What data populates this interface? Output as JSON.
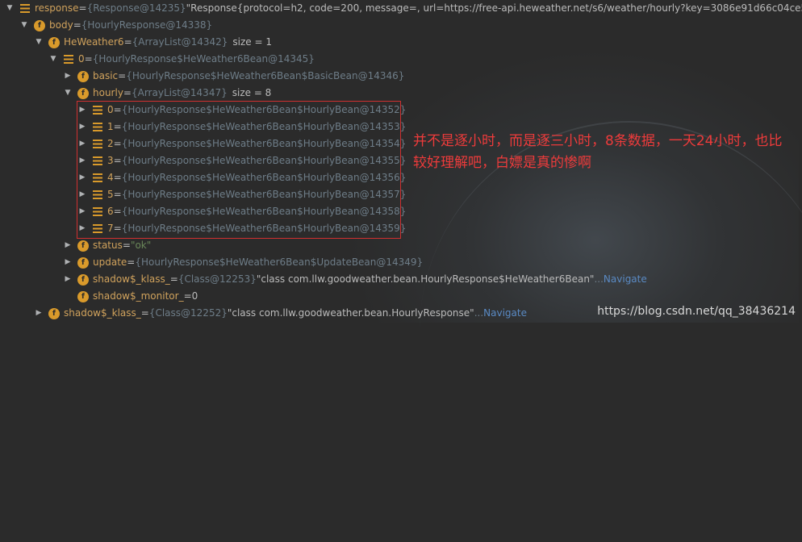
{
  "rows": [
    {
      "name": "response",
      "eq": " = ",
      "type": "{Response@14235}",
      "value": " \"Response{protocol=h2, code=200, message=, url=https://free-api.heweather.net/s6/weather/hourly?key=3086e91d66c04ce58...",
      "tail": " Vi"
    },
    {
      "name": "body",
      "eq": " = ",
      "type": "{HourlyResponse@14338}"
    },
    {
      "name": "HeWeather6",
      "eq": " = ",
      "type": "{ArrayList@14342}",
      "size": "size = 1"
    },
    {
      "name": "0",
      "eq": " = ",
      "type": "{HourlyResponse$HeWeather6Bean@14345}"
    },
    {
      "name": "basic",
      "eq": " = ",
      "type": "{HourlyResponse$HeWeather6Bean$BasicBean@14346}"
    },
    {
      "name": "hourly",
      "eq": " = ",
      "type": "{ArrayList@14347}",
      "size": "size = 8"
    },
    {
      "name": "0",
      "eq": " = ",
      "type": "{HourlyResponse$HeWeather6Bean$HourlyBean@14352}"
    },
    {
      "name": "1",
      "eq": " = ",
      "type": "{HourlyResponse$HeWeather6Bean$HourlyBean@14353}"
    },
    {
      "name": "2",
      "eq": " = ",
      "type": "{HourlyResponse$HeWeather6Bean$HourlyBean@14354}"
    },
    {
      "name": "3",
      "eq": " = ",
      "type": "{HourlyResponse$HeWeather6Bean$HourlyBean@14355}"
    },
    {
      "name": "4",
      "eq": " = ",
      "type": "{HourlyResponse$HeWeather6Bean$HourlyBean@14356}"
    },
    {
      "name": "5",
      "eq": " = ",
      "type": "{HourlyResponse$HeWeather6Bean$HourlyBean@14357}"
    },
    {
      "name": "6",
      "eq": " = ",
      "type": "{HourlyResponse$HeWeather6Bean$HourlyBean@14358}"
    },
    {
      "name": "7",
      "eq": " = ",
      "type": "{HourlyResponse$HeWeather6Bean$HourlyBean@14359}"
    },
    {
      "name": "status",
      "eq": " = ",
      "value": "\"ok\""
    },
    {
      "name": "update",
      "eq": " = ",
      "type": "{HourlyResponse$HeWeather6Bean$UpdateBean@14349}"
    },
    {
      "name": "shadow$_klass_",
      "eq": " = ",
      "type": "{Class@12253}",
      "value": " \"class com.llw.goodweather.bean.HourlyResponse$HeWeather6Bean\"",
      "ellipsis": " ... ",
      "nav": "Navigate"
    },
    {
      "name": "shadow$_monitor_",
      "eq": " = ",
      "value": "0"
    },
    {
      "name": "shadow$_klass_",
      "eq": " = ",
      "type": "{Class@12252}",
      "value": " \"class com.llw.goodweather.bean.HourlyResponse\"",
      "ellipsis": " ... ",
      "nav": "Navigate"
    }
  ],
  "annotation": "并不是逐小时，而是逐三小时，8条数据，一天24小时，也比较好理解吧，白嫖是真的惨啊",
  "watermark": "https://blog.csdn.net/qq_38436214",
  "colors": {
    "field": "#d0a25c",
    "type": "#6e7d88",
    "string": "#6a8759",
    "link": "#5a8ac4",
    "box": "#d03030",
    "annotation": "#ee3b3b"
  }
}
